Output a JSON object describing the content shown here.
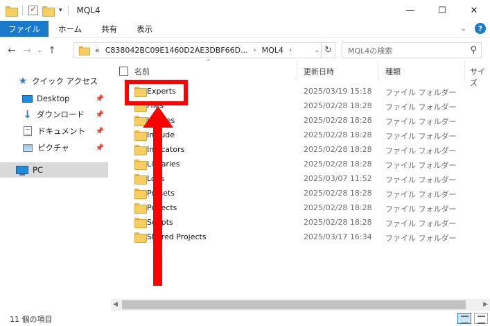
{
  "window": {
    "title": "MQL4",
    "qa_dropdown_glyph": "▾",
    "controls": {
      "minimize": "—",
      "maximize": "☐",
      "close": "✕"
    }
  },
  "ribbon": {
    "tabs": [
      "ファイル",
      "ホーム",
      "共有",
      "表示"
    ],
    "expand_glyph": "⌄",
    "help_glyph": "?"
  },
  "nav": {
    "back_glyph": "←",
    "forward_glyph": "→",
    "recent_glyph": "⌄",
    "up_glyph": "↑",
    "overflow_glyph": "«",
    "crumbs": [
      "C838042BC09E1460D2AE3DBF66D...",
      "MQL4"
    ],
    "crumb_sep": "›",
    "dropdown_glyph": "⌄",
    "refresh_glyph": "↻",
    "search_placeholder": "MQL4の検索",
    "search_glyph": "⚲"
  },
  "sidebar": {
    "items": [
      {
        "label": "クイック アクセス",
        "icon": "star-icon"
      },
      {
        "label": "Desktop",
        "icon": "desktop-icon",
        "pinned": true
      },
      {
        "label": "ダウンロード",
        "icon": "download-icon",
        "pinned": true
      },
      {
        "label": "ドキュメント",
        "icon": "document-icon",
        "pinned": true
      },
      {
        "label": "ピクチャ",
        "icon": "pictures-icon",
        "pinned": true
      },
      {
        "label": "PC",
        "icon": "pc-icon",
        "selected": true
      }
    ],
    "pin_glyph": "📌"
  },
  "columns": {
    "name": "名前",
    "date": "更新日時",
    "type": "種類",
    "size": "サイズ",
    "sort_glyph": "^"
  },
  "files": [
    {
      "name": "Experts",
      "date": "2025/03/19 15:18",
      "type": "ファイル フォルダー"
    },
    {
      "name": "Files",
      "date": "2025/02/28 18:28",
      "type": "ファイル フォルダー"
    },
    {
      "name": "Images",
      "date": "2025/02/28 18:28",
      "type": "ファイル フォルダー"
    },
    {
      "name": "Include",
      "date": "2025/02/28 18:28",
      "type": "ファイル フォルダー"
    },
    {
      "name": "Indicators",
      "date": "2025/02/28 18:28",
      "type": "ファイル フォルダー"
    },
    {
      "name": "Libraries",
      "date": "2025/02/28 18:28",
      "type": "ファイル フォルダー"
    },
    {
      "name": "Logs",
      "date": "2025/03/07 11:52",
      "type": "ファイル フォルダー"
    },
    {
      "name": "Presets",
      "date": "2025/02/28 18:28",
      "type": "ファイル フォルダー"
    },
    {
      "name": "Projects",
      "date": "2025/02/28 18:28",
      "type": "ファイル フォルダー"
    },
    {
      "name": "Scripts",
      "date": "2025/02/28 18:28",
      "type": "ファイル フォルダー"
    },
    {
      "name": "Shared Projects",
      "date": "2025/03/17 16:34",
      "type": "ファイル フォルダー"
    }
  ],
  "scrollbar": {
    "left_glyph": "◀",
    "right_glyph": "▶"
  },
  "status": {
    "count": "11 個の項目"
  },
  "annotation": {
    "color": "#ff0000"
  }
}
